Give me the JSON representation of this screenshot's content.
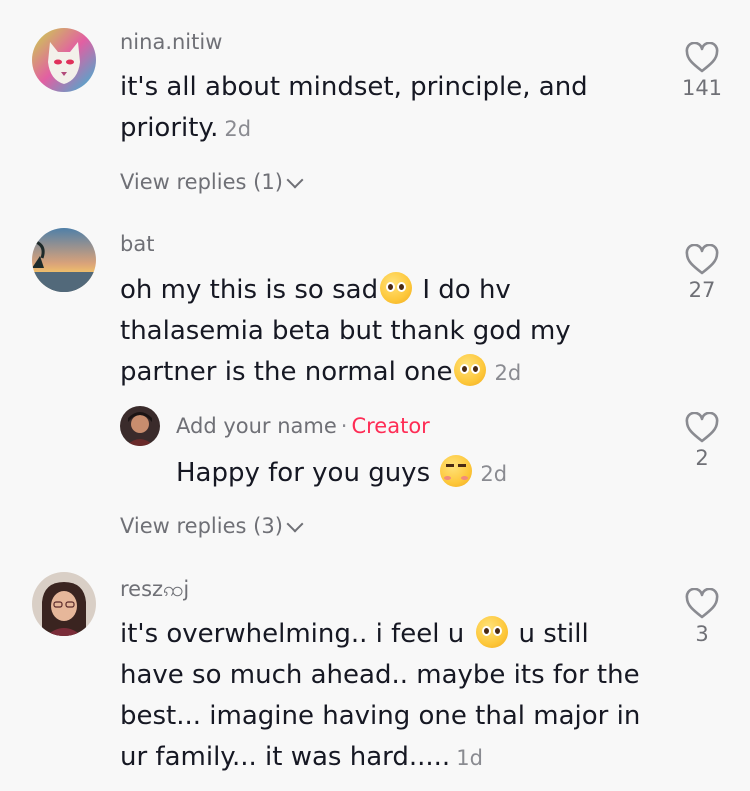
{
  "comments": [
    {
      "username": "nina.nitiw",
      "text_line1": "it's all about mindset, principle, and",
      "text_line2": "priority.",
      "date": "2d",
      "likes": "141",
      "view_replies": "View replies (1)"
    },
    {
      "username": "bat",
      "text_line1a": "oh my this is so sad",
      "text_line1b": " I do hv",
      "text_line2": "thalasemia beta but thank god my",
      "text_line3": "partner is the normal one",
      "date": "2d",
      "likes": "27",
      "reply": {
        "username": "Add your name",
        "separator": "·",
        "badge": "Creator",
        "text": "Happy for you guys",
        "date": "2d",
        "likes": "2"
      },
      "view_replies": "View replies (3)"
    },
    {
      "username": "reszꩡj",
      "text_line1a": "it's overwhelming.. i feel u",
      "text_line1b": " u still",
      "text_line2": "have so much ahead.. maybe its for the",
      "text_line3": "best... imagine having one thal major in",
      "text_line4": "ur family... it was hard.....",
      "date": "1d",
      "likes": "3"
    }
  ],
  "icons": {
    "like": "heart-outline-icon",
    "expand": "chevron-down-icon",
    "emoji_pleading": "pleading-face-emoji",
    "emoji_smiling_hearts": "smiling-face-with-hearts-emoji"
  },
  "colors": {
    "background": "#f8f8f8",
    "creator_badge": "#fe2c55",
    "secondary_text": "#6f7076"
  }
}
